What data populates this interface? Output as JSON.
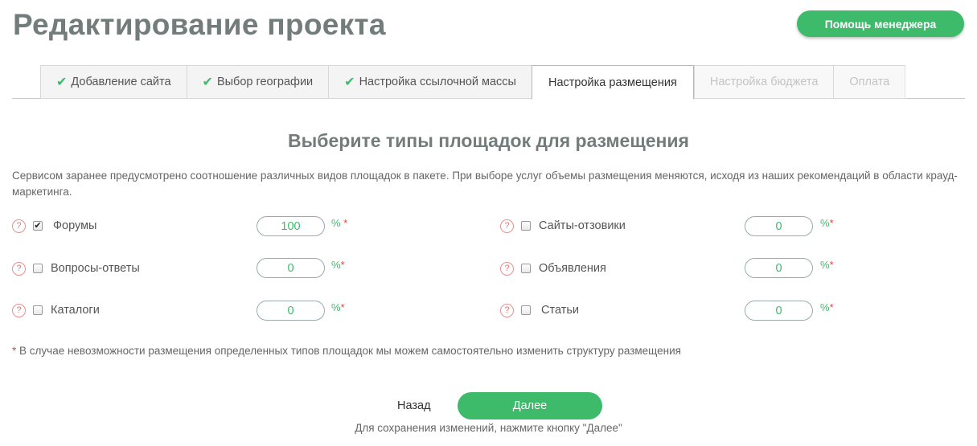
{
  "header": {
    "title": "Редактирование проекта",
    "manager_button": "Помощь менеджера"
  },
  "tabs": [
    {
      "label": "Добавление сайта",
      "state": "done"
    },
    {
      "label": "Выбор географии",
      "state": "done"
    },
    {
      "label": "Настройка ссылочной массы",
      "state": "done"
    },
    {
      "label": "Настройка размещения",
      "state": "active"
    },
    {
      "label": "Настройка бюджета",
      "state": "disabled"
    },
    {
      "label": "Оплата",
      "state": "disabled"
    }
  ],
  "section": {
    "title": "Выберите типы площадок для размещения",
    "intro": "Сервисом заранее предусмотрено соотношение различных видов площадок в пакете. При выборе услуг объемы размещения меняются, исходя из наших рекомендаций в области крауд-маркетинга."
  },
  "platforms": [
    {
      "label": "Форумы",
      "checked": true,
      "value": "100"
    },
    {
      "label": "Вопросы-ответы",
      "checked": false,
      "value": "0"
    },
    {
      "label": "Каталоги",
      "checked": false,
      "value": "0"
    },
    {
      "label": "Сайты-отзовики",
      "checked": false,
      "value": "0"
    },
    {
      "label": "Объявления",
      "checked": false,
      "value": "0"
    },
    {
      "label": "Статьи",
      "checked": false,
      "value": "0"
    }
  ],
  "percent_sign": "%",
  "required_mark": "*",
  "help_glyph": "?",
  "check_glyph": "✔",
  "note": "В случае невозможности размещения определенных типов площадок мы можем самостоятельно изменить структуру размещения",
  "footer": {
    "back_label": "Назад",
    "next_label": "Далее",
    "save_hint": "Для сохранения изменений, нажмите кнопку \"Далее\""
  },
  "colors": {
    "accent": "#3dbb6b",
    "title": "#727c7b",
    "required": "#e04444"
  }
}
